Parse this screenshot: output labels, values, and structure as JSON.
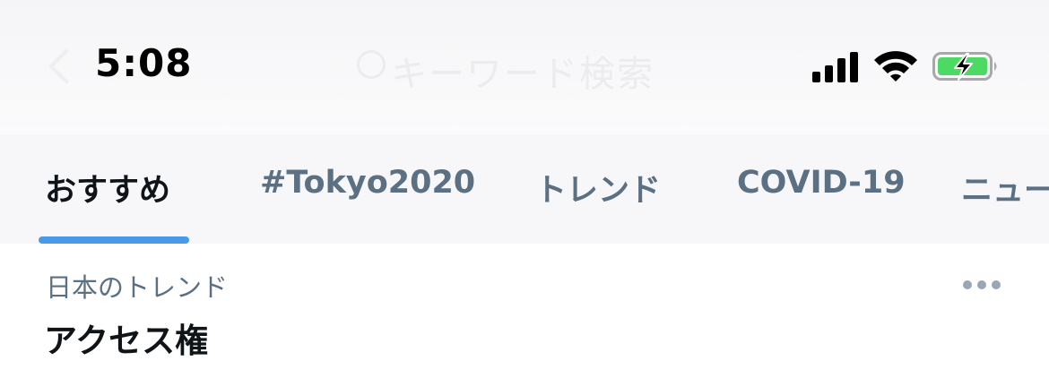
{
  "status_bar": {
    "time": "5:08",
    "signal_icon": "cellular-signal-icon",
    "wifi_icon": "wifi-icon",
    "battery_icon": "battery-charging-icon",
    "battery_color": "#4cd964"
  },
  "header": {
    "search_placeholder": "キーワード検索"
  },
  "tabs": [
    {
      "label": "おすすめ",
      "active": true
    },
    {
      "label": "#Tokyo2020",
      "active": false
    },
    {
      "label": "トレンド",
      "active": false
    },
    {
      "label": "COVID-19",
      "active": false
    },
    {
      "label": "ニュース",
      "active": false
    }
  ],
  "trend": {
    "context": "日本のトレンド",
    "title": "アクセス権",
    "more_icon": "more-options-icon"
  },
  "colors": {
    "accent": "#4a99e9",
    "primary_text": "#0f1419",
    "secondary_text": "#5b7083"
  }
}
